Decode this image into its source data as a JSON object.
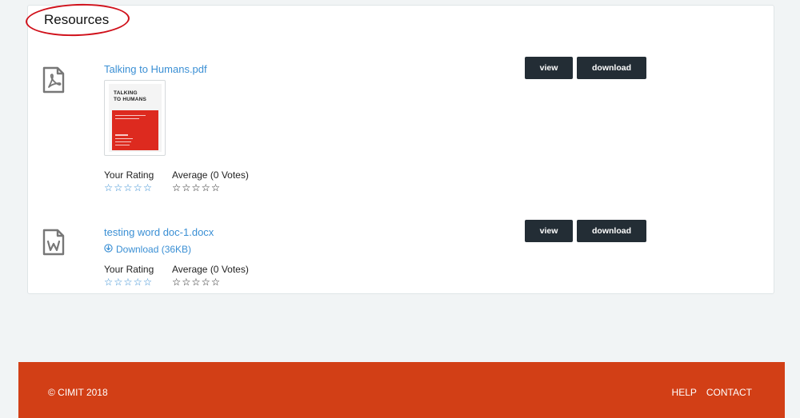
{
  "resources": {
    "title": "Resources",
    "items": [
      {
        "file_name": "Talking to Humans.pdf",
        "file_type_icon": "pdf-file-icon",
        "thumbnail": {
          "title_line1": "TALKING",
          "title_line2": "TO HUMANS"
        },
        "your_rating_label": "Your Rating",
        "average_label": "Average (0 Votes)",
        "your_rating_stars": "☆☆☆☆☆",
        "average_stars": "☆☆☆☆☆",
        "view_label": "view",
        "download_label": "download"
      },
      {
        "file_name": "testing word doc-1.docx",
        "file_type_icon": "word-file-icon",
        "download_size_label": "Download (36KB)",
        "your_rating_label": "Your Rating",
        "average_label": "Average (0 Votes)",
        "your_rating_stars": "☆☆☆☆☆",
        "average_stars": "☆☆☆☆☆",
        "view_label": "view",
        "download_label": "download"
      }
    ]
  },
  "footer": {
    "copyright": "© CIMIT 2018",
    "links": [
      "HELP",
      "CONTACT"
    ]
  },
  "colors": {
    "link_blue": "#3a8fd4",
    "button_dark": "#232d35",
    "footer_orange": "#d23f16",
    "annotation_red": "#d0101a"
  }
}
